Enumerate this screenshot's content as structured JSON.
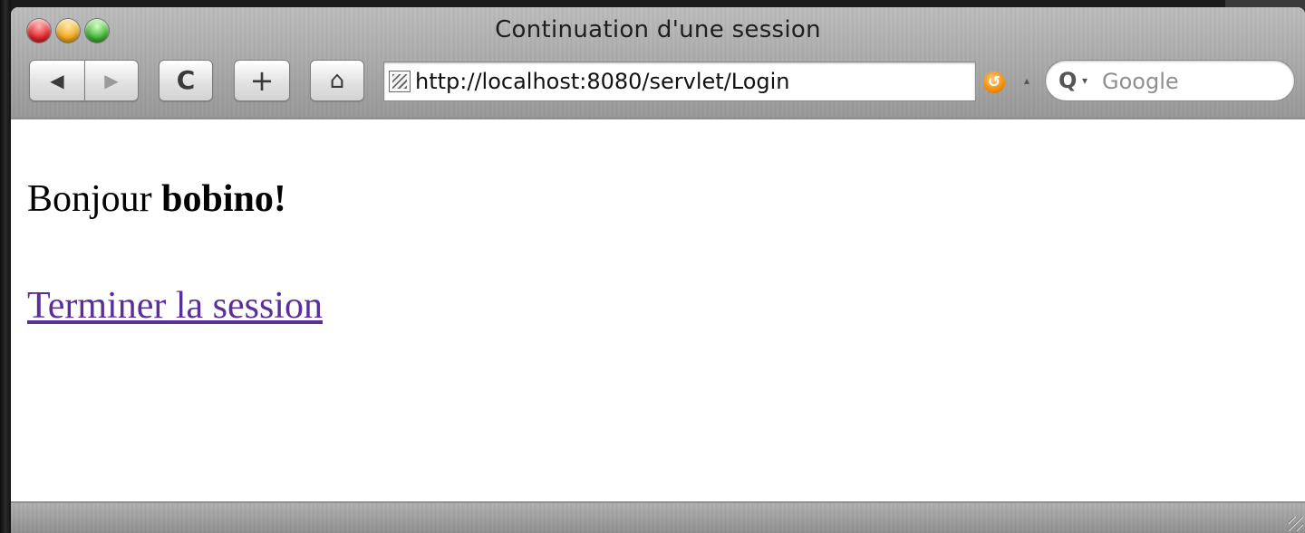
{
  "window": {
    "title": "Continuation d'une session"
  },
  "toolbar": {
    "back_icon": "◀",
    "forward_icon": "▶",
    "reload_icon": "C",
    "add_icon": "+",
    "home_icon": "⌂",
    "url": "http://localhost:8080/servlet/Login",
    "snapback_icon": "↺",
    "dropdown_icon": "▴",
    "search": {
      "icon": "Q",
      "caret": "▾",
      "placeholder": "Google"
    }
  },
  "page": {
    "greeting_prefix": "Bonjour ",
    "username": "bobino!",
    "logout_link": "Terminer la session"
  },
  "colors": {
    "link_visited": "#5a2f99",
    "snapback_orange": "#f08a00"
  }
}
